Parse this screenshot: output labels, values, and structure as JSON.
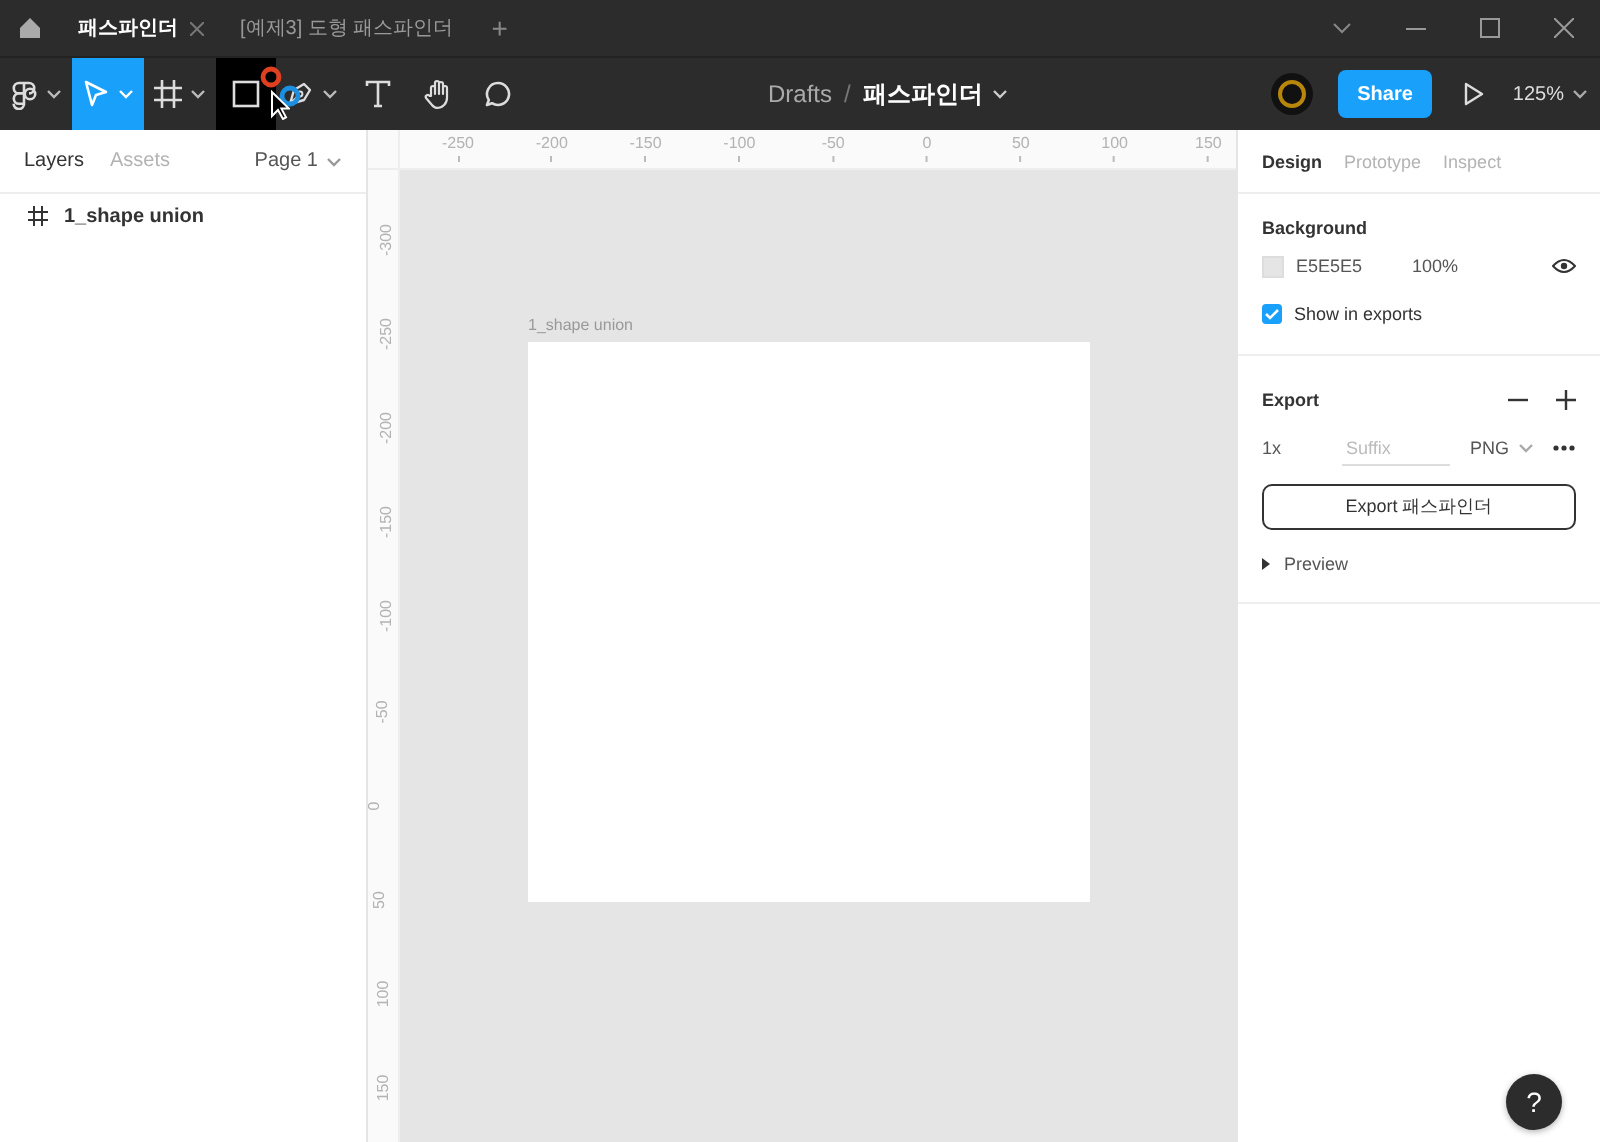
{
  "title_bar": {
    "tabs": [
      {
        "label": "패스파인더",
        "selected": true,
        "closable": true
      },
      {
        "label": "[예제3] 도형 패스파인더",
        "selected": false,
        "closable": false
      }
    ],
    "new_tab": "+"
  },
  "toolbar": {
    "tools": [
      {
        "kind": "main-menu",
        "selected": false,
        "pressed": false,
        "dropdown": true
      },
      {
        "kind": "move",
        "selected": true,
        "pressed": false,
        "dropdown": true
      },
      {
        "kind": "frame",
        "selected": false,
        "pressed": false,
        "dropdown": true
      },
      {
        "kind": "rectangle",
        "selected": false,
        "pressed": true,
        "dropdown": false
      },
      {
        "kind": "pen",
        "selected": false,
        "pressed": false,
        "dropdown": true
      },
      {
        "kind": "text",
        "selected": false,
        "pressed": false,
        "dropdown": false
      },
      {
        "kind": "hand",
        "selected": false,
        "pressed": false,
        "dropdown": false
      },
      {
        "kind": "comment",
        "selected": false,
        "pressed": false,
        "dropdown": false
      }
    ],
    "breadcrumb": {
      "folder": "Drafts",
      "separator": "/",
      "file": "패스파인더"
    },
    "share": "Share",
    "zoom": "125%"
  },
  "left_panel": {
    "tabs": [
      {
        "label": "Layers",
        "selected": true
      },
      {
        "label": "Assets",
        "selected": false
      }
    ],
    "page": "Page 1",
    "layers": [
      {
        "name": "1_shape union",
        "kind": "frame"
      }
    ]
  },
  "rulers": {
    "horizontal": [
      "-250",
      "-200",
      "-150",
      "-100",
      "-50",
      "0",
      "50",
      "100",
      "150"
    ],
    "vertical": [
      "-300",
      "-250",
      "-200",
      "-150",
      "-100",
      "-50",
      "0",
      "50",
      "100",
      "150"
    ]
  },
  "canvas": {
    "frame": {
      "label": "1_shape union"
    }
  },
  "right_panel": {
    "tabs": [
      {
        "label": "Design",
        "selected": true
      },
      {
        "label": "Prototype",
        "selected": false
      },
      {
        "label": "Inspect",
        "selected": false
      }
    ],
    "background": {
      "title": "Background",
      "color": "E5E5E5",
      "opacity": "100%",
      "visible": true,
      "show_in_exports": {
        "label": "Show in exports",
        "checked": true
      }
    },
    "export": {
      "title": "Export",
      "scale": "1x",
      "suffix_placeholder": "Suffix",
      "format": "PNG",
      "button": "Export 패스파인더",
      "preview": "Preview"
    }
  },
  "help": "?"
}
